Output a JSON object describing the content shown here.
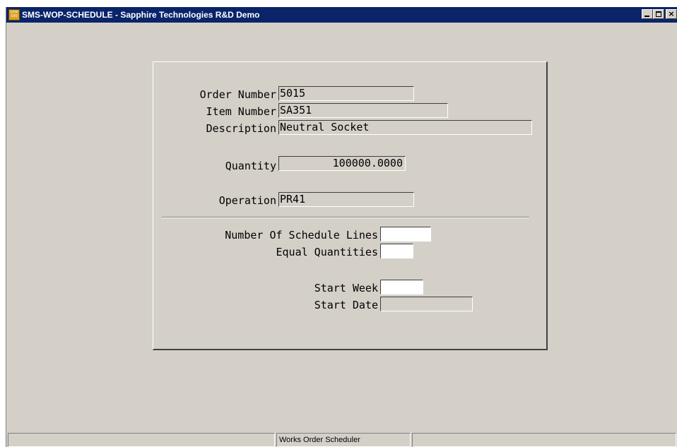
{
  "window": {
    "title": "SMS-WOP-SCHEDULE - Sapphire Technologies R&D Demo",
    "icon": "Line 100",
    "icon_name": "line100-app-icon",
    "buttons": {
      "minimize": "minimize",
      "maximize": "maximize",
      "close": "×"
    }
  },
  "form": {
    "order_number": {
      "label": "Order Number",
      "value": "5015"
    },
    "item_number": {
      "label": "Item Number",
      "value": "SA351"
    },
    "description": {
      "label": "Description",
      "value": "Neutral Socket"
    },
    "quantity": {
      "label": "Quantity",
      "value": "100000.0000"
    },
    "operation": {
      "label": "Operation",
      "value": "PR41"
    },
    "schedule_lines": {
      "label": "Number Of Schedule Lines",
      "value": ""
    },
    "equal_quantities": {
      "label": "Equal Quantities",
      "value": ""
    },
    "start_week": {
      "label": "Start Week",
      "value": ""
    },
    "start_date": {
      "label": "Start Date",
      "value": ""
    }
  },
  "status_bar": {
    "left": "",
    "center": "Works Order Scheduler",
    "right": ""
  },
  "colors": {
    "title_bar": "#0a246a",
    "window_face": "#d4d0c8",
    "edit_field": "#ffffff"
  }
}
